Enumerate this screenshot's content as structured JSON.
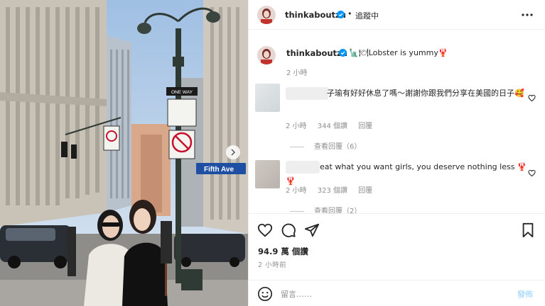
{
  "post": {
    "username": "thinkaboutzu",
    "follow_state": "追蹤中",
    "dot": "•",
    "caption_emoji": "🗽🍽",
    "caption_text": "Lobster is yummy🦞",
    "caption_time": "2 小時",
    "likes": "94.9 萬 個讚",
    "post_time": "2 小時前"
  },
  "comments": [
    {
      "text": "子瑜有好好休息了嗎～謝謝你跟我們分享在美國的日子🥰",
      "time": "2 小時",
      "likes": "344 個讚",
      "reply_label": "回覆",
      "view_replies": "查看回覆（6）"
    },
    {
      "text": "eat what you want girls, you deserve nothing less 🦞🦞",
      "time": "2 小時",
      "likes": "323 個讚",
      "reply_label": "回覆",
      "view_replies": "查看回覆（2）"
    }
  ],
  "comment_box": {
    "placeholder": "留言……",
    "post_label": "發佈"
  },
  "photo": {
    "street_sign": "Fifth Ave",
    "one_way_sign": "ONE WAY"
  },
  "icons": {
    "verified": "verified-badge-icon",
    "more": "more-options-icon",
    "like": "heart-icon",
    "comment": "comment-bubble-icon",
    "share": "share-paper-plane-icon",
    "save": "bookmark-icon",
    "emoji": "emoji-smiley-icon",
    "carousel": "chevron-right-icon"
  },
  "colors": {
    "verified": "#0095f6",
    "post_button_disabled": "#b2dffc",
    "muted_text": "#8e8e8e",
    "street_sign": "#1f4fa3"
  }
}
